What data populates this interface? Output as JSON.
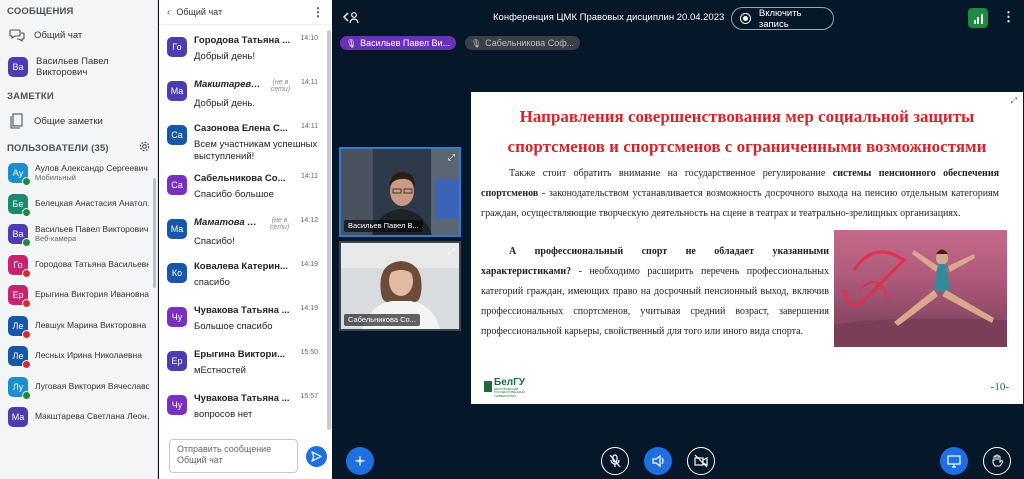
{
  "sidebar": {
    "messages_title": "СООБЩЕНИЯ",
    "public_chat": "Общий чат",
    "private_chat": {
      "initials": "Ва",
      "name": "Васильев Павел Викторович"
    },
    "notes_title": "ЗАМЕТКИ",
    "shared_notes": "Общие заметки",
    "users_title": "ПОЛЬЗОВАТЕЛИ (35)",
    "users": [
      {
        "initials": "Ау",
        "name": "Аулов Александр Сергеевич",
        "sub": "Мобильный",
        "color": "#1b8fcb",
        "status": "mic"
      },
      {
        "initials": "Бе",
        "name": "Белецкая Анастасия Анатольевна",
        "sub": "",
        "color": "#1a8a6e",
        "status": "mic"
      },
      {
        "initials": "Ва",
        "name": "Васильев Павел Викторович",
        "sub": "Веб-камера",
        "color": "#4d3bb0",
        "status": "mic"
      },
      {
        "initials": "Го",
        "name": "Городова Татьяна Васильевна",
        "sub": "",
        "color": "#c9226e",
        "status": "muted"
      },
      {
        "initials": "Ер",
        "name": "Ерыгина Виктория Ивановна",
        "sub": "",
        "color": "#c9226e",
        "status": "muted"
      },
      {
        "initials": "Ле",
        "name": "Левшук Марина Викторовна",
        "sub": "",
        "color": "#1657a8",
        "status": "muted"
      },
      {
        "initials": "Ле",
        "name": "Лесных Ирина Николаевна",
        "sub": "",
        "color": "#1657a8",
        "status": "muted"
      },
      {
        "initials": "Лу",
        "name": "Луговая Виктория Вячеславовна",
        "sub": "",
        "color": "#1b8fcb",
        "status": "mic"
      },
      {
        "initials": "Ма",
        "name": "Макштарева Светлана Леонидовна",
        "sub": "",
        "color": "#4d3bb0",
        "status": "none"
      }
    ]
  },
  "chat": {
    "title": "Общий чат",
    "messages": [
      {
        "initials": "Го",
        "name": "Городова Татьяна ...",
        "time": "14:10",
        "offline": "",
        "text": "Добрый день!",
        "color": "#4d3bb0",
        "italic": false
      },
      {
        "initials": "Ма",
        "name": "Макштарева...",
        "time": "14:11",
        "offline": "(не в сети)",
        "text": "Добрый день.",
        "color": "#4d3bb0",
        "italic": true
      },
      {
        "initials": "Са",
        "name": "Сазонова Елена С...",
        "time": "14:11",
        "offline": "",
        "text": "Всем участникам успешных выступлений!",
        "color": "#1657a8",
        "italic": false
      },
      {
        "initials": "Са",
        "name": "Сабельникова Со...",
        "time": "14:11",
        "offline": "",
        "text": "Спасибо большое",
        "color": "#7b2fbe",
        "italic": false
      },
      {
        "initials": "Ма",
        "name": "Маматова С...",
        "time": "14:12",
        "offline": "(не в сети)",
        "text": "Спасибо!",
        "color": "#1657a8",
        "italic": true
      },
      {
        "initials": "Ко",
        "name": "Ковалева Катерин...",
        "time": "14:19",
        "offline": "",
        "text": "спасибо",
        "color": "#1657a8",
        "italic": false
      },
      {
        "initials": "Чу",
        "name": "Чувакова Татьяна ...",
        "time": "14:19",
        "offline": "",
        "text": "Большое спасибо",
        "color": "#7b2fbe",
        "italic": false
      },
      {
        "initials": "Ер",
        "name": "Ерыгина Виктори...",
        "time": "15:50",
        "offline": "",
        "text": "мЕстностей",
        "color": "#4d3bb0",
        "italic": false
      },
      {
        "initials": "Чу",
        "name": "Чувакова Татьяна ...",
        "time": "15:57",
        "offline": "",
        "text": "вопросов нет",
        "color": "#7b2fbe",
        "italic": false
      }
    ],
    "input_placeholder": "Отправить сообщение Общий чат"
  },
  "topbar": {
    "title": "Конференция ЦМК Правовых дисциплин 20.04.2023",
    "record_label": "Включить запись"
  },
  "talkers": [
    {
      "name": "Васильев Павел Ви...",
      "color": "#6b2fb8"
    },
    {
      "name": "Сабельникова Соф...",
      "color": "#3a3f48"
    }
  ],
  "videos": [
    {
      "name": "Васильев Павел В..."
    },
    {
      "name": "Сабельникова Со..."
    }
  ],
  "slide": {
    "title_line1": "Направления совершенствования мер социальной защиты",
    "title_line2": "спортсменов и спортсменов с ограниченными возможностями",
    "para1_a": "Также стоит обратить внимание на государственное регулирование ",
    "para1_b": "системы пенсионного обеспечения спортсменов",
    "para1_c": " - законодательством устанавливается возможность досрочного выхода на пенсию отдельным категориям граждан, осуществляющие творческую деятельность на сцене в театрах и театрально-зрелищных организациях.",
    "para2_a": "А профессиональный спорт не обладает указанными характеристиками?",
    "para2_b": " - необходимо расширить перечень профессиональных категорий граждан, имеющих право на досрочный пенсионный выход, включив профессиональных спортсменов, учитывая средний возраст, завершения профессиональной карьеры, свойственный для того или иного вида спорта.",
    "logo_text": "БелГУ",
    "logo_sub": "БЕЛГОРОДСКИЙ ГОСУДАРСТВЕННЫЙ УНИВЕРСИТЕТ",
    "page": "-10-"
  }
}
